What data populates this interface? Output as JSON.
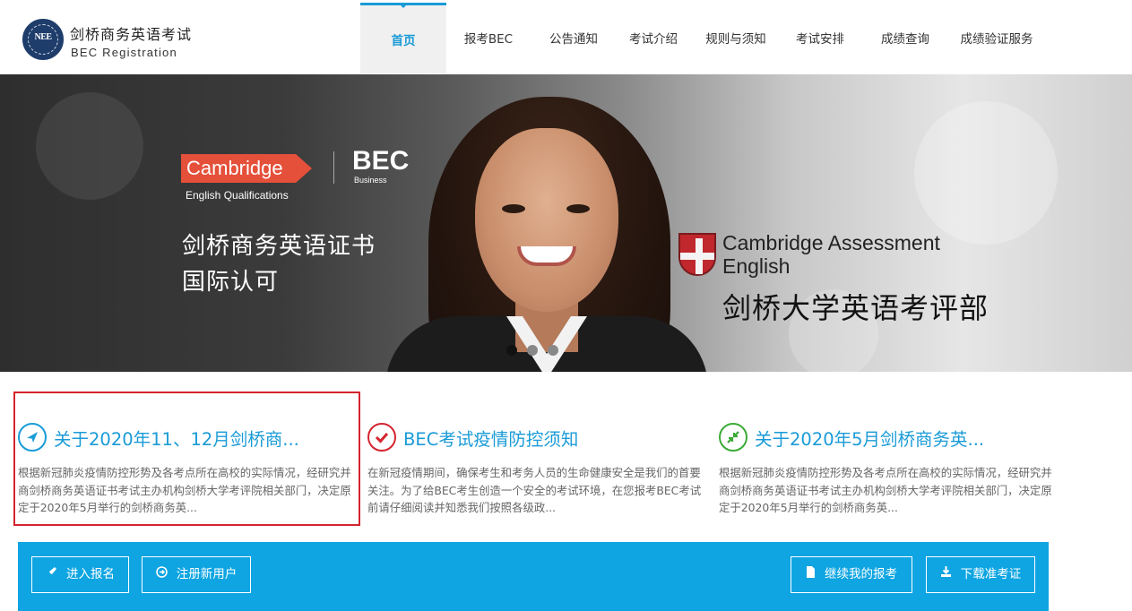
{
  "header": {
    "logo_text": "NEE",
    "brand_cn": "剑桥商务英语考试",
    "brand_en": "BEC Registration",
    "nav": [
      {
        "label": "首页",
        "active": true
      },
      {
        "label": "报考BEC",
        "active": false
      },
      {
        "label": "公告通知",
        "active": false
      },
      {
        "label": "考试介绍",
        "active": false
      },
      {
        "label": "规则与须知",
        "active": false
      },
      {
        "label": "考试安排",
        "active": false
      },
      {
        "label": "成绩查询",
        "active": false
      },
      {
        "label": "成绩验证服务",
        "active": false
      }
    ]
  },
  "banner": {
    "cambridge": "Cambridge",
    "english_qualifications": "English Qualifications",
    "bec": "BEC",
    "business": "Business",
    "line1": "剑桥商务英语证书",
    "line2": "国际认可",
    "cae_line1": "Cambridge Assessment",
    "cae_line2": "English",
    "cae_cn": "剑桥大学英语考评部",
    "slide_count": 3,
    "active_slide": 1
  },
  "cards": [
    {
      "icon": "navigation-arrow-icon",
      "icon_color": "#1a9bd7",
      "title": "关于2020年11、12月剑桥商...",
      "body": "根据新冠肺炎疫情防控形势及各考点所在高校的实际情况，经研究并商剑桥商务英语证书考试主办机构剑桥大学考评院相关部门，决定原定于2020年5月举行的剑桥商务英..."
    },
    {
      "icon": "check-icon",
      "icon_color": "#d4242f",
      "title": "BEC考试疫情防控须知",
      "body": "在新冠疫情期间，确保考生和考务人员的生命健康安全是我们的首要关注。为了给BEC考生创造一个安全的考试环境，在您报考BEC考试前请仔细阅读并知悉我们按照各级政..."
    },
    {
      "icon": "collapse-arrows-icon",
      "icon_color": "#3aaa35",
      "title": "关于2020年5月剑桥商务英...",
      "body": "根据新冠肺炎疫情防控形势及各考点所在高校的实际情况，经研究并商剑桥商务英语证书考试主办机构剑桥大学考评院相关部门，决定原定于2020年5月举行的剑桥商务英..."
    }
  ],
  "actions": {
    "enter_registration": "进入报名",
    "register_new_user": "注册新用户",
    "continue_registration": "继续我的报考",
    "download_admission": "下载准考证"
  },
  "colors": {
    "accent": "#1a9bd7",
    "action_bar": "#0ea5e2",
    "highlight_box": "#d4242f",
    "cambridge_red": "#e5503a"
  }
}
